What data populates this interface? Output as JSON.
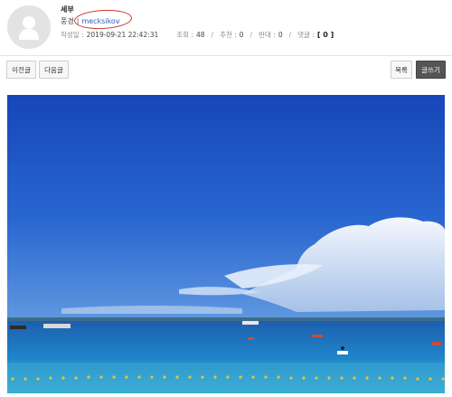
{
  "post": {
    "title": "세부",
    "author_label": "풍경",
    "author_separator": "|",
    "author_name": "mecksikov",
    "date_label": "작성일 :",
    "date": "2019-09-21 22:42:31",
    "views_label": "조회 :",
    "views": "48",
    "recommend_label": "추천 :",
    "recommend": "0",
    "oppose_label": "반대 :",
    "oppose": "0",
    "comments_label": "댓글 :",
    "comments": "[ 0 ]",
    "slash": "/"
  },
  "nav": {
    "prev_label": "이전글",
    "next_label": "다음글",
    "list_label": "목록",
    "write_label": "글쓰기"
  },
  "colors": {
    "author_link": "#2d5db8",
    "annotation_circle": "#c83a30",
    "write_button_bg": "#555555",
    "sky": "#1f56c4",
    "sea": "#1a78c0"
  },
  "icons": {
    "avatar": "default-user-avatar-icon"
  }
}
